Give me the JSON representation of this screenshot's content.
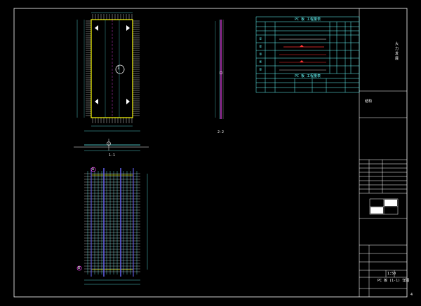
{
  "colors": {
    "background": "#000000",
    "frame": "#ffffff",
    "rebar": "#ffffff",
    "panel_outline": "#ffff00",
    "table_lines": "#00ffff",
    "dimension": "#00ffff",
    "accent_red": "#ff3030",
    "accent_magenta": "#ff40ff",
    "accent_blue": "#6060ff"
  },
  "drawing": {
    "plan_view_tag": "1",
    "section_1_label": "1-1",
    "section_2_label": "2-2",
    "grid_mark_a": "A",
    "grid_mark_b": "B",
    "page_number": "4"
  },
  "table": {
    "title": "PC 板 工程量表",
    "row_labels": [
      "①",
      "②",
      "③",
      "④",
      "⑤"
    ],
    "section_title_2": "PC 板 工程量表"
  },
  "title_block": {
    "vertical_title": "大 力 发 展",
    "drawing_name": "PC 板 (1-1) 详图",
    "sheet_label": "结构",
    "scale_note": "1:50"
  }
}
